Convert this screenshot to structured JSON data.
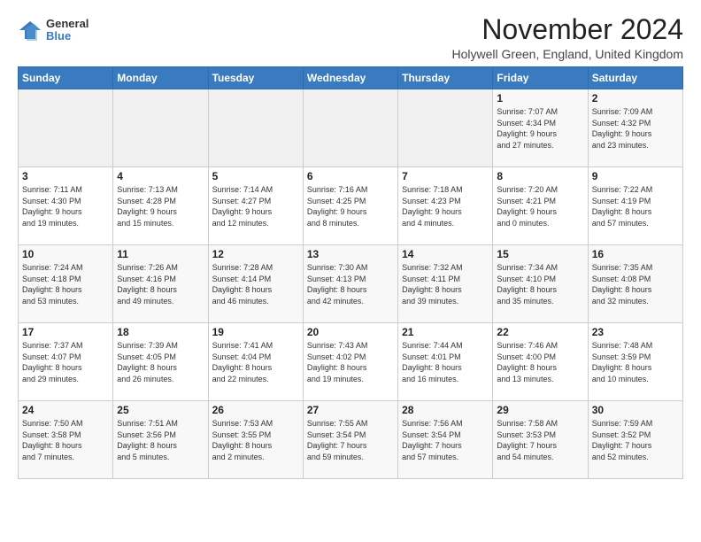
{
  "header": {
    "logo_general": "General",
    "logo_blue": "Blue",
    "title": "November 2024",
    "location": "Holywell Green, England, United Kingdom"
  },
  "weekdays": [
    "Sunday",
    "Monday",
    "Tuesday",
    "Wednesday",
    "Thursday",
    "Friday",
    "Saturday"
  ],
  "weeks": [
    [
      {
        "day": "",
        "info": ""
      },
      {
        "day": "",
        "info": ""
      },
      {
        "day": "",
        "info": ""
      },
      {
        "day": "",
        "info": ""
      },
      {
        "day": "",
        "info": ""
      },
      {
        "day": "1",
        "info": "Sunrise: 7:07 AM\nSunset: 4:34 PM\nDaylight: 9 hours\nand 27 minutes."
      },
      {
        "day": "2",
        "info": "Sunrise: 7:09 AM\nSunset: 4:32 PM\nDaylight: 9 hours\nand 23 minutes."
      }
    ],
    [
      {
        "day": "3",
        "info": "Sunrise: 7:11 AM\nSunset: 4:30 PM\nDaylight: 9 hours\nand 19 minutes."
      },
      {
        "day": "4",
        "info": "Sunrise: 7:13 AM\nSunset: 4:28 PM\nDaylight: 9 hours\nand 15 minutes."
      },
      {
        "day": "5",
        "info": "Sunrise: 7:14 AM\nSunset: 4:27 PM\nDaylight: 9 hours\nand 12 minutes."
      },
      {
        "day": "6",
        "info": "Sunrise: 7:16 AM\nSunset: 4:25 PM\nDaylight: 9 hours\nand 8 minutes."
      },
      {
        "day": "7",
        "info": "Sunrise: 7:18 AM\nSunset: 4:23 PM\nDaylight: 9 hours\nand 4 minutes."
      },
      {
        "day": "8",
        "info": "Sunrise: 7:20 AM\nSunset: 4:21 PM\nDaylight: 9 hours\nand 0 minutes."
      },
      {
        "day": "9",
        "info": "Sunrise: 7:22 AM\nSunset: 4:19 PM\nDaylight: 8 hours\nand 57 minutes."
      }
    ],
    [
      {
        "day": "10",
        "info": "Sunrise: 7:24 AM\nSunset: 4:18 PM\nDaylight: 8 hours\nand 53 minutes."
      },
      {
        "day": "11",
        "info": "Sunrise: 7:26 AM\nSunset: 4:16 PM\nDaylight: 8 hours\nand 49 minutes."
      },
      {
        "day": "12",
        "info": "Sunrise: 7:28 AM\nSunset: 4:14 PM\nDaylight: 8 hours\nand 46 minutes."
      },
      {
        "day": "13",
        "info": "Sunrise: 7:30 AM\nSunset: 4:13 PM\nDaylight: 8 hours\nand 42 minutes."
      },
      {
        "day": "14",
        "info": "Sunrise: 7:32 AM\nSunset: 4:11 PM\nDaylight: 8 hours\nand 39 minutes."
      },
      {
        "day": "15",
        "info": "Sunrise: 7:34 AM\nSunset: 4:10 PM\nDaylight: 8 hours\nand 35 minutes."
      },
      {
        "day": "16",
        "info": "Sunrise: 7:35 AM\nSunset: 4:08 PM\nDaylight: 8 hours\nand 32 minutes."
      }
    ],
    [
      {
        "day": "17",
        "info": "Sunrise: 7:37 AM\nSunset: 4:07 PM\nDaylight: 8 hours\nand 29 minutes."
      },
      {
        "day": "18",
        "info": "Sunrise: 7:39 AM\nSunset: 4:05 PM\nDaylight: 8 hours\nand 26 minutes."
      },
      {
        "day": "19",
        "info": "Sunrise: 7:41 AM\nSunset: 4:04 PM\nDaylight: 8 hours\nand 22 minutes."
      },
      {
        "day": "20",
        "info": "Sunrise: 7:43 AM\nSunset: 4:02 PM\nDaylight: 8 hours\nand 19 minutes."
      },
      {
        "day": "21",
        "info": "Sunrise: 7:44 AM\nSunset: 4:01 PM\nDaylight: 8 hours\nand 16 minutes."
      },
      {
        "day": "22",
        "info": "Sunrise: 7:46 AM\nSunset: 4:00 PM\nDaylight: 8 hours\nand 13 minutes."
      },
      {
        "day": "23",
        "info": "Sunrise: 7:48 AM\nSunset: 3:59 PM\nDaylight: 8 hours\nand 10 minutes."
      }
    ],
    [
      {
        "day": "24",
        "info": "Sunrise: 7:50 AM\nSunset: 3:58 PM\nDaylight: 8 hours\nand 7 minutes."
      },
      {
        "day": "25",
        "info": "Sunrise: 7:51 AM\nSunset: 3:56 PM\nDaylight: 8 hours\nand 5 minutes."
      },
      {
        "day": "26",
        "info": "Sunrise: 7:53 AM\nSunset: 3:55 PM\nDaylight: 8 hours\nand 2 minutes."
      },
      {
        "day": "27",
        "info": "Sunrise: 7:55 AM\nSunset: 3:54 PM\nDaylight: 7 hours\nand 59 minutes."
      },
      {
        "day": "28",
        "info": "Sunrise: 7:56 AM\nSunset: 3:54 PM\nDaylight: 7 hours\nand 57 minutes."
      },
      {
        "day": "29",
        "info": "Sunrise: 7:58 AM\nSunset: 3:53 PM\nDaylight: 7 hours\nand 54 minutes."
      },
      {
        "day": "30",
        "info": "Sunrise: 7:59 AM\nSunset: 3:52 PM\nDaylight: 7 hours\nand 52 minutes."
      }
    ]
  ]
}
